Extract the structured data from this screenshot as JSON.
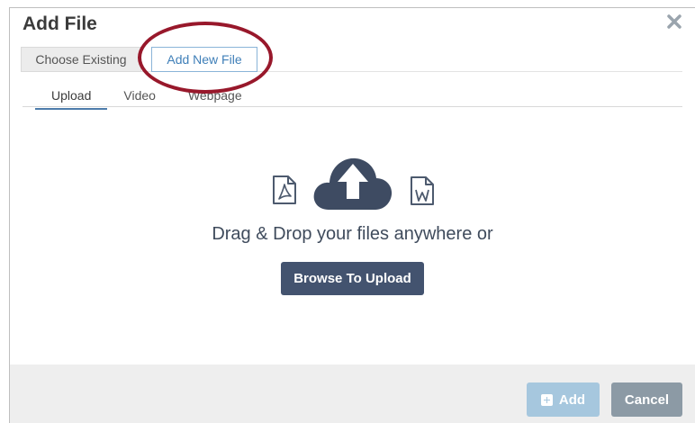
{
  "dialog": {
    "title": "Add File",
    "close_icon": "close-icon"
  },
  "source_tabs": [
    {
      "label": "Choose Existing",
      "active": false
    },
    {
      "label": "Add New File",
      "active": true
    }
  ],
  "sub_tabs": [
    {
      "label": "Upload",
      "active": true
    },
    {
      "label": "Video",
      "active": false
    },
    {
      "label": "Webpage",
      "active": false
    }
  ],
  "upload": {
    "icons": [
      "pdf-file-icon",
      "cloud-upload-icon",
      "word-file-icon"
    ],
    "drop_text": "Drag & Drop your files anywhere or",
    "browse_label": "Browse To Upload"
  },
  "footer": {
    "add_label": "Add",
    "cancel_label": "Cancel"
  },
  "colors": {
    "highlight": "#98182b",
    "browse_button": "#43536f",
    "add_button": "#a6c7de",
    "cancel_button": "#8c9aa5",
    "active_tab": "#3f7fb8"
  }
}
